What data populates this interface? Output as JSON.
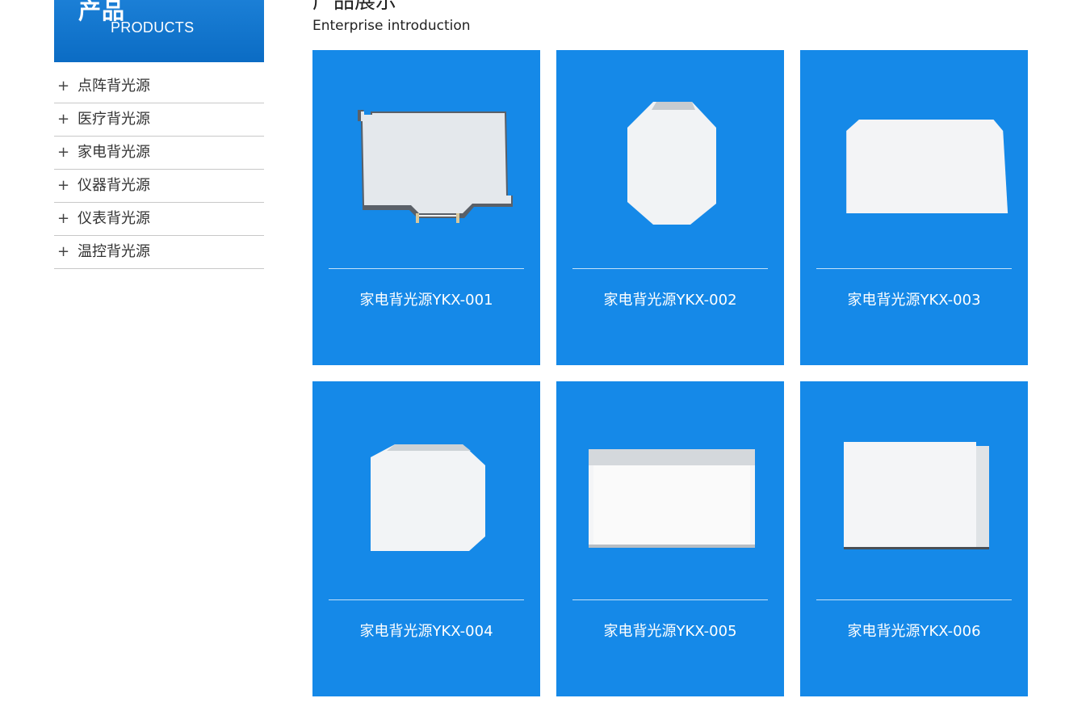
{
  "sidebar": {
    "heading_cn": "产品",
    "heading_en": "PRODUCTS",
    "items": [
      {
        "label": "点阵背光源"
      },
      {
        "label": "医疗背光源"
      },
      {
        "label": "家电背光源"
      },
      {
        "label": "仪器背光源"
      },
      {
        "label": "仪表背光源"
      },
      {
        "label": "温控背光源"
      }
    ],
    "expand_symbol": "+"
  },
  "main": {
    "title": "产品展示",
    "subtitle": "Enterprise introduction",
    "products": [
      {
        "name": "家电背光源YKX-001"
      },
      {
        "name": "家电背光源YKX-002"
      },
      {
        "name": "家电背光源YKX-003"
      },
      {
        "name": "家电背光源YKX-004"
      },
      {
        "name": "家电背光源YKX-005"
      },
      {
        "name": "家电背光源YKX-006"
      }
    ]
  },
  "colors": {
    "accent": "#1589e8",
    "sidebar_header": "#0b6cc4",
    "panel": "#e8ebee"
  }
}
